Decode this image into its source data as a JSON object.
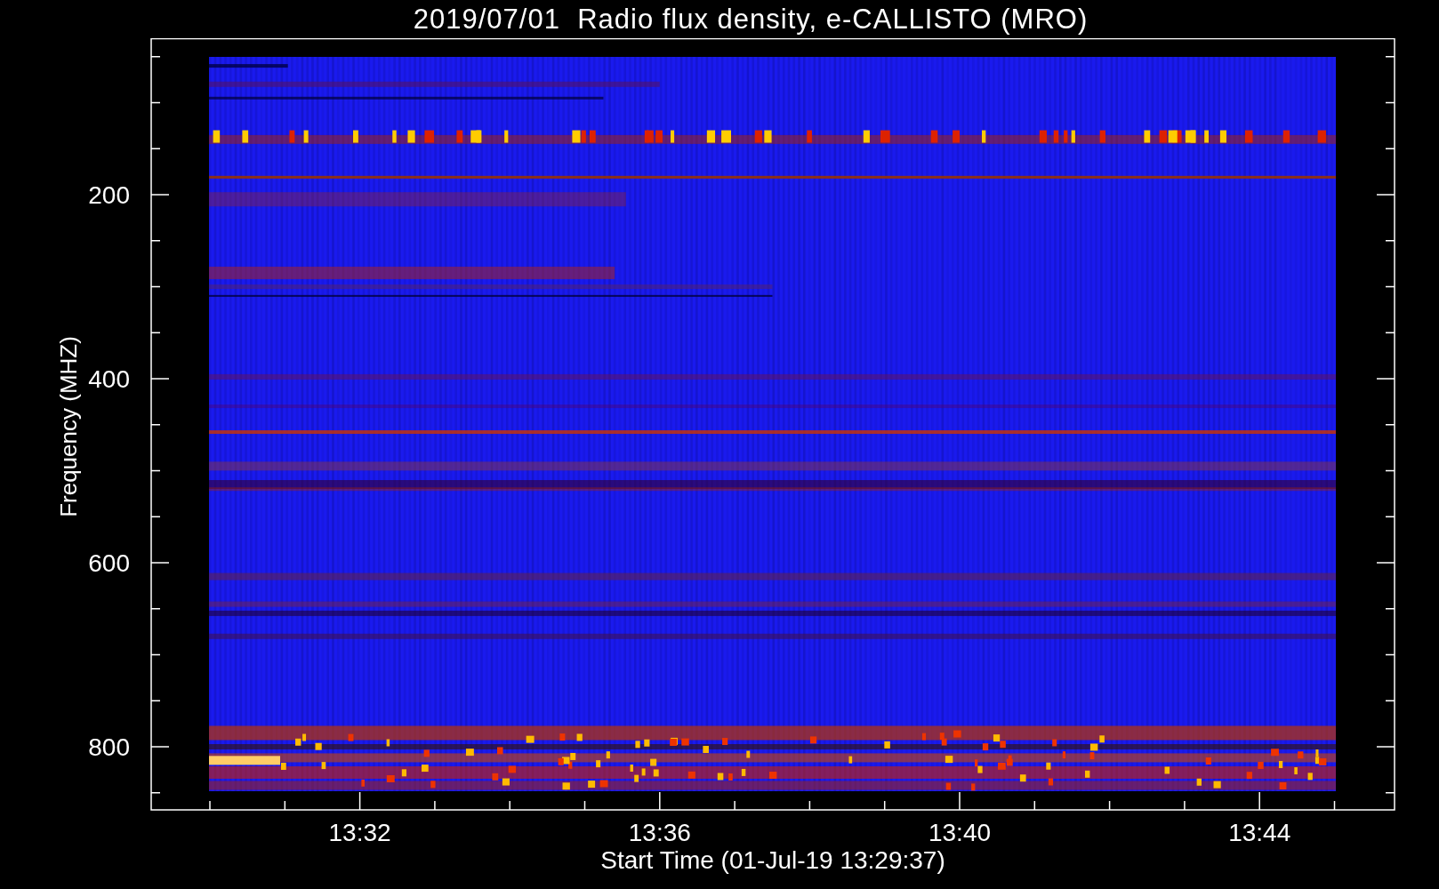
{
  "title": "2019/07/01  Radio flux density, e-CALLISTO (MRO)",
  "y_axis": {
    "label": "Frequency (MHZ)",
    "tick_labels": [
      "200",
      "400",
      "600",
      "800"
    ]
  },
  "x_axis": {
    "label": "Start Time (01-Jul-19 13:29:37)",
    "tick_labels": [
      "13:32",
      "13:36",
      "13:40",
      "13:44"
    ]
  }
}
